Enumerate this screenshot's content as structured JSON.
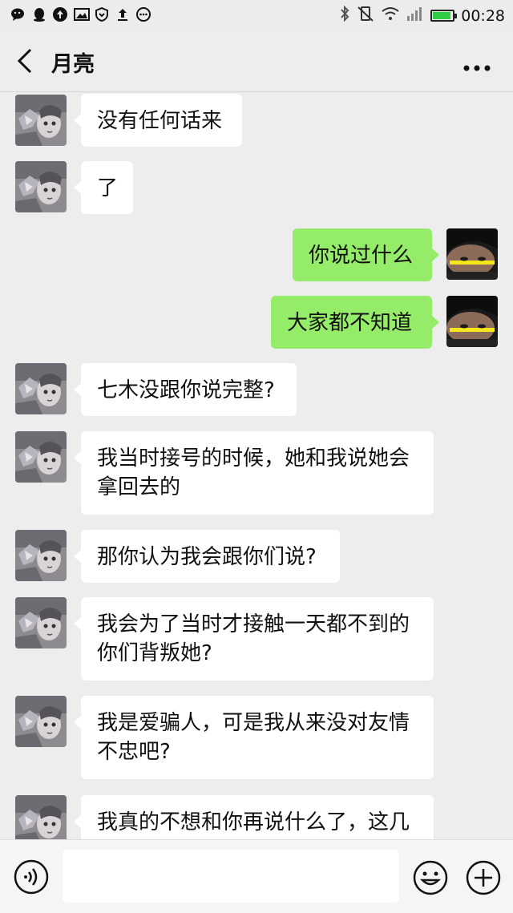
{
  "status_bar": {
    "time": "00:28",
    "battery_level": 0.9,
    "left_icons": [
      "wechat-icon",
      "qq-icon",
      "upload-circle-icon",
      "gallery-icon",
      "shield-icon",
      "upload-icon",
      "messages-icon"
    ],
    "right_icons": [
      "bluetooth-icon",
      "vibrate-off-icon",
      "wifi-icon",
      "signal-icon",
      "battery-icon"
    ]
  },
  "header": {
    "title": "月亮",
    "back_icon": "chevron-left-icon",
    "more_icon": "more-dots-icon"
  },
  "messages": [
    {
      "side": "left",
      "text": "没有任何话来"
    },
    {
      "side": "left",
      "text": "了"
    },
    {
      "side": "right",
      "text": "你说过什么"
    },
    {
      "side": "right",
      "text": "大家都不知道"
    },
    {
      "side": "left",
      "text": "七木没跟你说完整?"
    },
    {
      "side": "left",
      "line1": "我当时接号的时候，她和我说她会",
      "line2": "拿回去的"
    },
    {
      "side": "left",
      "text": "那你认为我会跟你们说?"
    },
    {
      "side": "left",
      "line1": "我会为了当时才接触一天都不到的",
      "line2": "你们背叛她?"
    },
    {
      "side": "left",
      "line1": "我是爱骗人，可是我从来没对友情",
      "line2": "不忠吧?"
    },
    {
      "side": "left",
      "line1": "我真的不想和你再说什么了，这几"
    }
  ],
  "input_bar": {
    "voice_icon": "voice-icon",
    "emoji_icon": "emoji-icon",
    "plus_icon": "plus-icon",
    "placeholder": ""
  },
  "colors": {
    "background": "#ededed",
    "sent_bubble": "#95ec69",
    "received_bubble": "#ffffff"
  }
}
